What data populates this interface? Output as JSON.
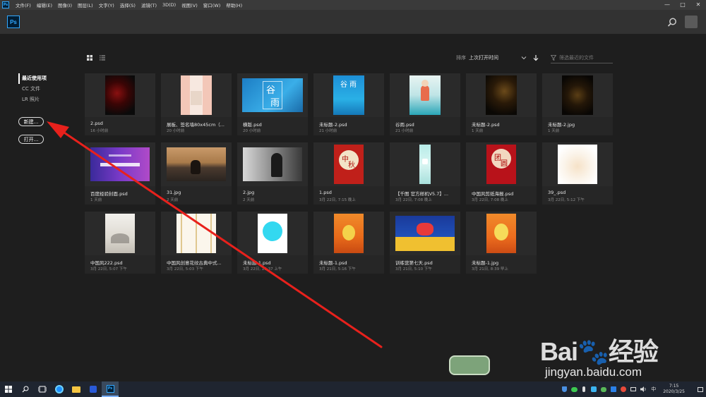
{
  "menubar": {
    "app_short": "Ps",
    "items": [
      "文件(F)",
      "编辑(E)",
      "图像(I)",
      "图层(L)",
      "文字(Y)",
      "选择(S)",
      "滤镜(T)",
      "3D(D)",
      "视图(V)",
      "窗口(W)",
      "帮助(H)"
    ],
    "minimize": "—",
    "maximize": "□",
    "close": "✕"
  },
  "header": {
    "logo": "Ps"
  },
  "sidebar": {
    "items": [
      {
        "label": "最近使用项",
        "active": true
      },
      {
        "label": "CC 文件",
        "active": false
      },
      {
        "label": "LR 照片",
        "active": false
      }
    ],
    "new_button": "新建...",
    "open_button": "打开..."
  },
  "toolbar": {
    "sort_label": "排序",
    "sort_value": "上次打开时间",
    "filter_placeholder": "筛选最近的文件"
  },
  "files": [
    {
      "name": "2.psd",
      "time": "16 小时前"
    },
    {
      "name": "展板、签名墙80x45cm（...",
      "time": "20 小时前"
    },
    {
      "name": "横版.psd",
      "time": "20 小时前"
    },
    {
      "name": "未标题-2.psd",
      "time": "21 小时前"
    },
    {
      "name": "谷雨.psd",
      "time": "21 小时前"
    },
    {
      "name": "未标题-2.psd",
      "time": "1 天前"
    },
    {
      "name": "未标题-2.jpg",
      "time": "1 天前"
    },
    {
      "name": "百度经验封面.psd",
      "time": "1 天前"
    },
    {
      "name": "31.jpg",
      "time": "2 天前"
    },
    {
      "name": "2.jpg",
      "time": "2 天前"
    },
    {
      "name": "1.psd",
      "time": "3月 22日, 7:15 晚上"
    },
    {
      "name": "【千图 官方样机V5.7】...",
      "time": "3月 22日, 7:08 晚上"
    },
    {
      "name": "中国风剪纸海报.psd",
      "time": "3月 22日, 7:08 晚上"
    },
    {
      "name": "39_.psd",
      "time": "3月 22日, 5:12 下午"
    },
    {
      "name": "中国风222.psd",
      "time": "3月 22日, 5:07 下午"
    },
    {
      "name": "中国风创意花纹古典中式...",
      "time": "3月 22日, 5:03 下午"
    },
    {
      "name": "未标题-1.psd",
      "time": "3月 22日, 10:37 上午"
    },
    {
      "name": "未标题-1.psd",
      "time": "3月 21日, 5:16 下午"
    },
    {
      "name": "训练营第七天.psd",
      "time": "3月 21日, 5:10 下午"
    },
    {
      "name": "未标题-1.jpg",
      "time": "3月 21日, 8:39 早上"
    }
  ],
  "thumb_text": {
    "guyu_a": "谷",
    "guyu_b": "雨",
    "zhongqiu_a": "中",
    "zhongqiu_b": "秋",
    "tuanyuan_a": "团",
    "tuanyuan_b": "圆"
  },
  "watermark": {
    "logo": "Bai🐾经验",
    "url": "jingyan.baidu.com"
  },
  "taskbar": {
    "ime": "中",
    "time": "7:15",
    "date": "2020/3/25"
  },
  "colors": {
    "ps_blue": "#31a8ff",
    "annotation_red": "#e8211c"
  }
}
